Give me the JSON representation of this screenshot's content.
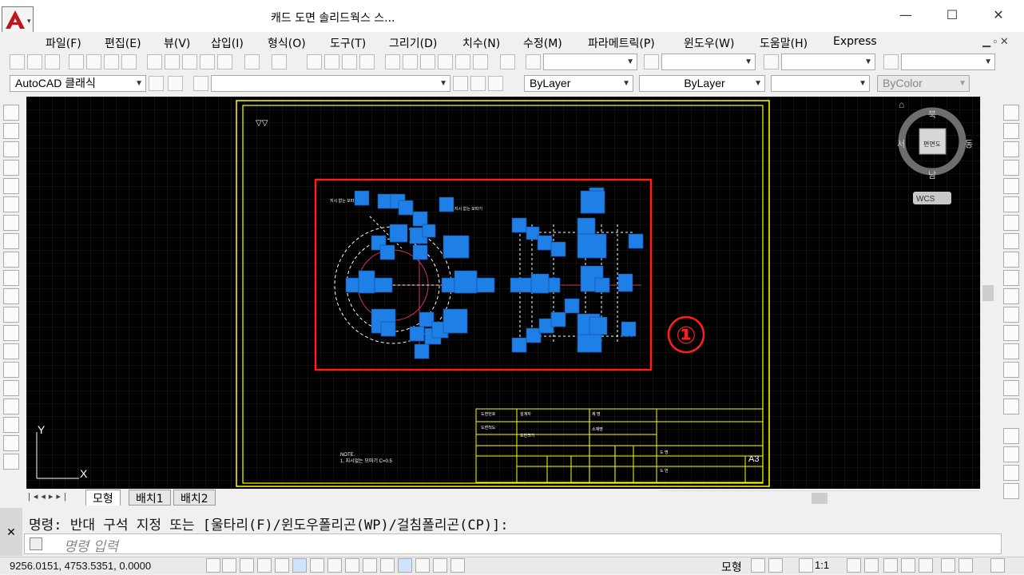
{
  "window": {
    "title": "캐드 도면 솔리드웍스 스...",
    "minimize": "—",
    "maximize": "☐",
    "close": "✕"
  },
  "menu": [
    "파일(F)",
    "편집(E)",
    "뷰(V)",
    "삽입(I)",
    "형식(O)",
    "도구(T)",
    "그리기(D)",
    "치수(N)",
    "수정(M)",
    "파라메트릭(P)",
    "윈도우(W)",
    "도움말(H)",
    "Express"
  ],
  "toolbar": {
    "workspace": "AutoCAD 클래식",
    "color": "ByLayer",
    "linetype": "ByLayer",
    "plotstyle": "ByColor"
  },
  "drawing": {
    "callout": "①",
    "note_title": "NOTE.",
    "note_body": "1. 지시없는 모따기 C=0.5",
    "sheet_size": "A3"
  },
  "viewcube": {
    "north": "북",
    "south": "남",
    "east": "동",
    "west": "서",
    "face": "편면도",
    "wcs": "WCS"
  },
  "tabs": [
    "모형",
    "배치1",
    "배치2"
  ],
  "command": {
    "prompt": "명령: 반대 구석 지정 또는 [울타리(F)/윈도우폴리곤(WP)/걸침폴리곤(CP)]:",
    "placeholder": "명령 입력"
  },
  "status": {
    "coords": "9256.0151, 4753.5351, 0.0000",
    "model": "모형",
    "scale": "1:1"
  },
  "ucs": {
    "x": "X",
    "y": "Y"
  },
  "colors": {
    "canvas": "#000000",
    "frame": "#ffff00",
    "selection": "#ff1e1e",
    "grips": "#1e7fe6",
    "accent_logo": "#c0161b"
  }
}
